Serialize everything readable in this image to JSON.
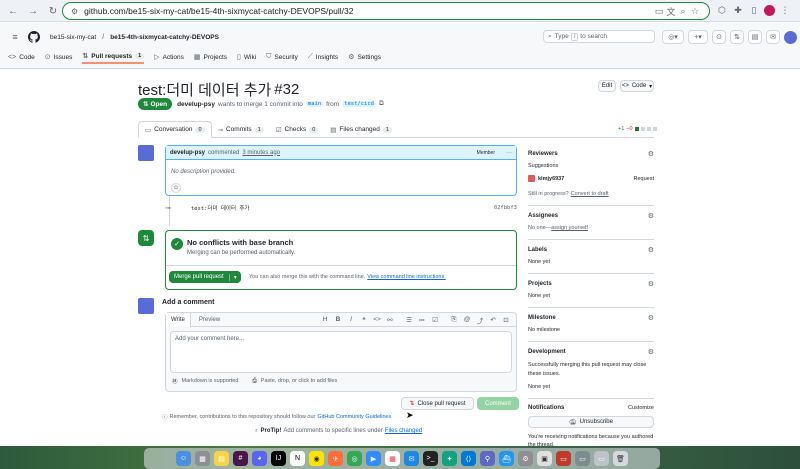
{
  "browser": {
    "url": "github.com/be15-six-my-cat/be15-4th-sixmycat-catchy-DEVOPS/pull/32"
  },
  "header": {
    "org": "be15-six-my-cat",
    "separator": "/",
    "repo": "be15-4th-sixmycat-catchy-DEVOPS",
    "search_placeholder_type": "Type",
    "search_placeholder_key": "/",
    "search_placeholder_rest": "to search"
  },
  "repo_tabs": [
    {
      "label": "Code",
      "icon": "code-icon"
    },
    {
      "label": "Issues",
      "icon": "issue-icon"
    },
    {
      "label": "Pull requests",
      "icon": "pull-request-icon",
      "count": "1"
    },
    {
      "label": "Actions",
      "icon": "play-icon"
    },
    {
      "label": "Projects",
      "icon": "table-icon"
    },
    {
      "label": "Wiki",
      "icon": "book-icon"
    },
    {
      "label": "Security",
      "icon": "shield-icon"
    },
    {
      "label": "Insights",
      "icon": "graph-icon"
    },
    {
      "label": "Settings",
      "icon": "gear-icon"
    }
  ],
  "pr": {
    "title": "test:더미 데이터 추가",
    "number": "#32",
    "status": "Open",
    "author": "develup-psy",
    "merge_text": "wants to merge 1 commit into",
    "base_branch": "main",
    "from_text": "from",
    "head_branch": "test/cicd",
    "edit_label": "Edit",
    "code_label": "Code"
  },
  "pr_tabs": [
    {
      "label": "Conversation",
      "count": "0"
    },
    {
      "label": "Commits",
      "count": "1"
    },
    {
      "label": "Checks",
      "count": "0"
    },
    {
      "label": "Files changed",
      "count": "1"
    }
  ],
  "diffstat": {
    "added": "+1",
    "removed": "−0"
  },
  "comment": {
    "author": "develup-psy",
    "action": "commented",
    "time": "3 minutes ago",
    "role": "Member",
    "body": "No description provided."
  },
  "commit": {
    "message": "test:더미 데이터 추가",
    "sha": "02fbbf3"
  },
  "merge": {
    "title": "No conflicts with base branch",
    "subtitle": "Merging can be performed automatically.",
    "button_label": "Merge pull request",
    "also_text": "You can also merge this with the command line.",
    "instructions_link": "View command line instructions."
  },
  "add_comment": {
    "heading": "Add a comment",
    "write_tab": "Write",
    "preview_tab": "Preview",
    "placeholder": "Add your comment here...",
    "markdown_note": "Markdown is supported",
    "attach_note": "Paste, drop, or click to add files",
    "close_button": "Close pull request",
    "comment_button": "Comment",
    "reminder_prefix": "Remember, contributions to this repository should follow our",
    "reminder_link": "GitHub Community Guidelines",
    "protip_label": "ProTip!",
    "protip_text": "Add comments to specific lines under",
    "protip_link": "Files changed",
    "toolbar_heading": "H",
    "toolbar_bold": "B",
    "toolbar_italic": "I"
  },
  "sidebar": {
    "reviewers_heading": "Reviewers",
    "suggestions": "Suggestions",
    "reviewer_name": "kimjy6937",
    "request_label": "Request",
    "still_progress": "Still in progress?",
    "convert_draft": "Convert to draft",
    "assignees_heading": "Assignees",
    "assignees_text": "No one—",
    "assign_yourself": "assign yourself",
    "labels_heading": "Labels",
    "labels_text": "None yet",
    "projects_heading": "Projects",
    "projects_text": "None yet",
    "milestone_heading": "Milestone",
    "milestone_text": "No milestone",
    "development_heading": "Development",
    "development_text": "Successfully merging this pull request may close these issues.",
    "development_none": "None yet",
    "notifications_heading": "Notifications",
    "customize_label": "Customize",
    "unsubscribe_label": "Unsubscribe",
    "notif_text": "You're receiving notifications because you authored the thread."
  },
  "colors": {
    "green": "#1f883d",
    "link": "#0969da",
    "comment_header": "#ddf4ff",
    "avatar": "#5a6ad6"
  }
}
